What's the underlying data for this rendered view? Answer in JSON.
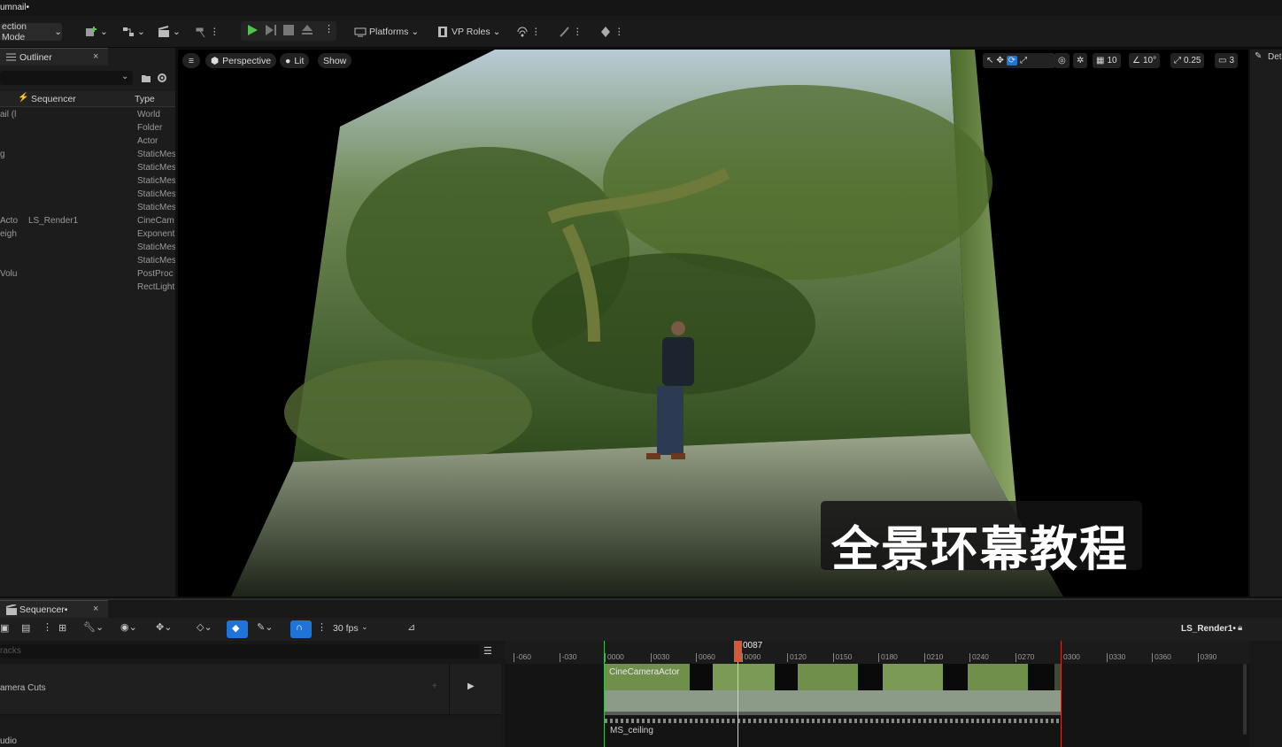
{
  "window": {
    "title": "umnail•"
  },
  "toolbar": {
    "selection_mode": "ection Mode",
    "platforms": "Platforms",
    "vp_roles": "VP Roles"
  },
  "outliner": {
    "tab_label": "Outliner",
    "close": "×",
    "col_sequencer": "Sequencer",
    "col_type": "Type",
    "rows": [
      {
        "name": "ail (l",
        "seq": "",
        "type": "World"
      },
      {
        "name": "",
        "seq": "",
        "type": "Folder"
      },
      {
        "name": "",
        "seq": "",
        "type": "Actor"
      },
      {
        "name": "g",
        "seq": "",
        "type": "StaticMes"
      },
      {
        "name": "",
        "seq": "",
        "type": "StaticMes"
      },
      {
        "name": "",
        "seq": "",
        "type": "StaticMes"
      },
      {
        "name": "",
        "seq": "",
        "type": "StaticMes"
      },
      {
        "name": "",
        "seq": "",
        "type": "StaticMes"
      },
      {
        "name": "Acto",
        "seq": "LS_Render1",
        "type": "CineCam"
      },
      {
        "name": "eigh",
        "seq": "",
        "type": "Exponent"
      },
      {
        "name": "",
        "seq": "",
        "type": "StaticMes"
      },
      {
        "name": "",
        "seq": "",
        "type": "StaticMes"
      },
      {
        "name": "Volu",
        "seq": "",
        "type": "PostProc"
      },
      {
        "name": "",
        "seq": "",
        "type": "RectLight"
      }
    ]
  },
  "viewport": {
    "perspective": "Perspective",
    "lit": "Lit",
    "show": "Show",
    "grid_snap": "10",
    "rot_snap": "10°",
    "scale_snap": "0.25",
    "cam_speed": "3",
    "caption": "全景环幕教程"
  },
  "details": {
    "label": "Det"
  },
  "sequencer": {
    "tab_label": "Sequencer•",
    "close": "×",
    "fps": "30 fps",
    "sequence_name": "LS_Render1•",
    "search_placeholder": "racks",
    "camera_cuts_track": "amera Cuts",
    "audio_track": "udio",
    "playhead_frame": "0087",
    "ticks": [
      "-060",
      "-030",
      "0000",
      "0030",
      "0060",
      "0090",
      "0120",
      "0150",
      "0180",
      "0210",
      "0240",
      "0270",
      "0300",
      "0330",
      "0360",
      "0390"
    ],
    "cam_clip_label": "CineCameraActor",
    "ms_label": "MS_ceiling"
  }
}
